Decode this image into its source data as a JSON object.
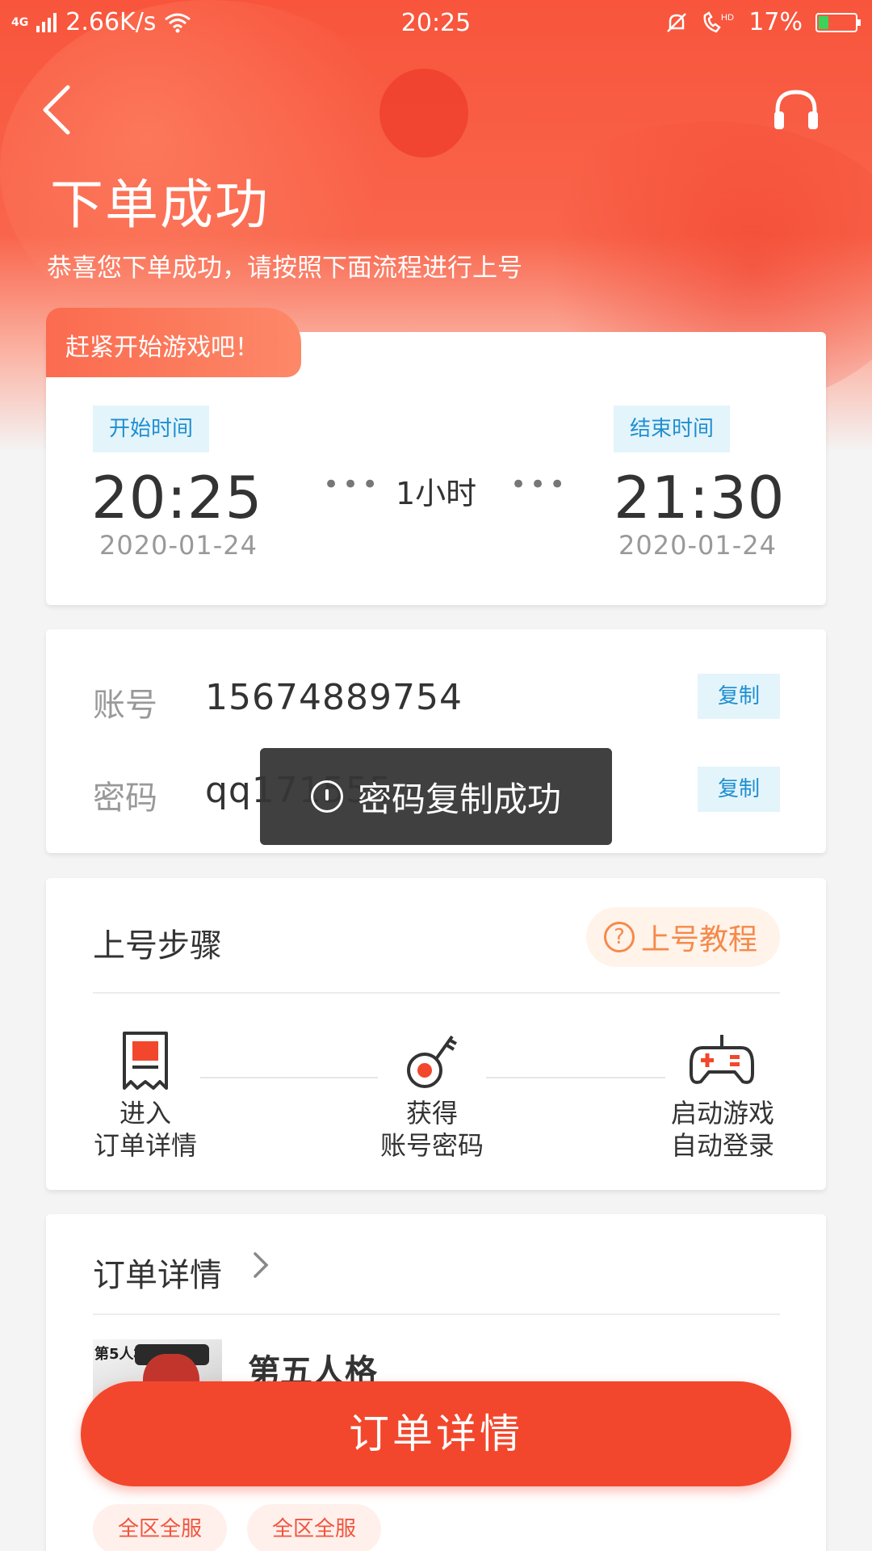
{
  "status_bar": {
    "network": "4G",
    "speed": "2.66K/s",
    "time": "20:25",
    "battery": "17%"
  },
  "header": {
    "title": "下单成功",
    "subtitle": "恭喜您下单成功，请按照下面流程进行上号"
  },
  "time_card": {
    "badge": "赶紧开始游戏吧！",
    "start_label": "开始时间",
    "start_time": "20:25",
    "start_date": "2020-01-24",
    "duration": "1小时",
    "end_label": "结束时间",
    "end_time": "21:30",
    "end_date": "2020-01-24",
    "dots": "•••"
  },
  "account_card": {
    "account_label": "账号",
    "account_value": "15674889754",
    "password_label": "密码",
    "password_value": "qq171555",
    "copy_label": "复制"
  },
  "toast": {
    "message": "密码复制成功"
  },
  "steps_card": {
    "title": "上号步骤",
    "tutorial_button": "上号教程",
    "steps": [
      {
        "line1": "进入",
        "line2": "订单详情",
        "icon": "receipt-icon"
      },
      {
        "line1": "获得",
        "line2": "账号密码",
        "icon": "key-icon"
      },
      {
        "line1": "启动游戏",
        "line2": "自动登录",
        "icon": "gamepad-icon"
      }
    ]
  },
  "order_card": {
    "title": "订单详情",
    "game_name": "第五人格",
    "thumb_text": "第5人格",
    "tags": [
      "全区全服",
      "全区全服"
    ]
  },
  "bottom_button": {
    "label": "订单详情"
  },
  "colors": {
    "primary": "#f2472c",
    "accent_blue": "#1f8fd0",
    "tutorial_orange": "#f58a4a"
  }
}
